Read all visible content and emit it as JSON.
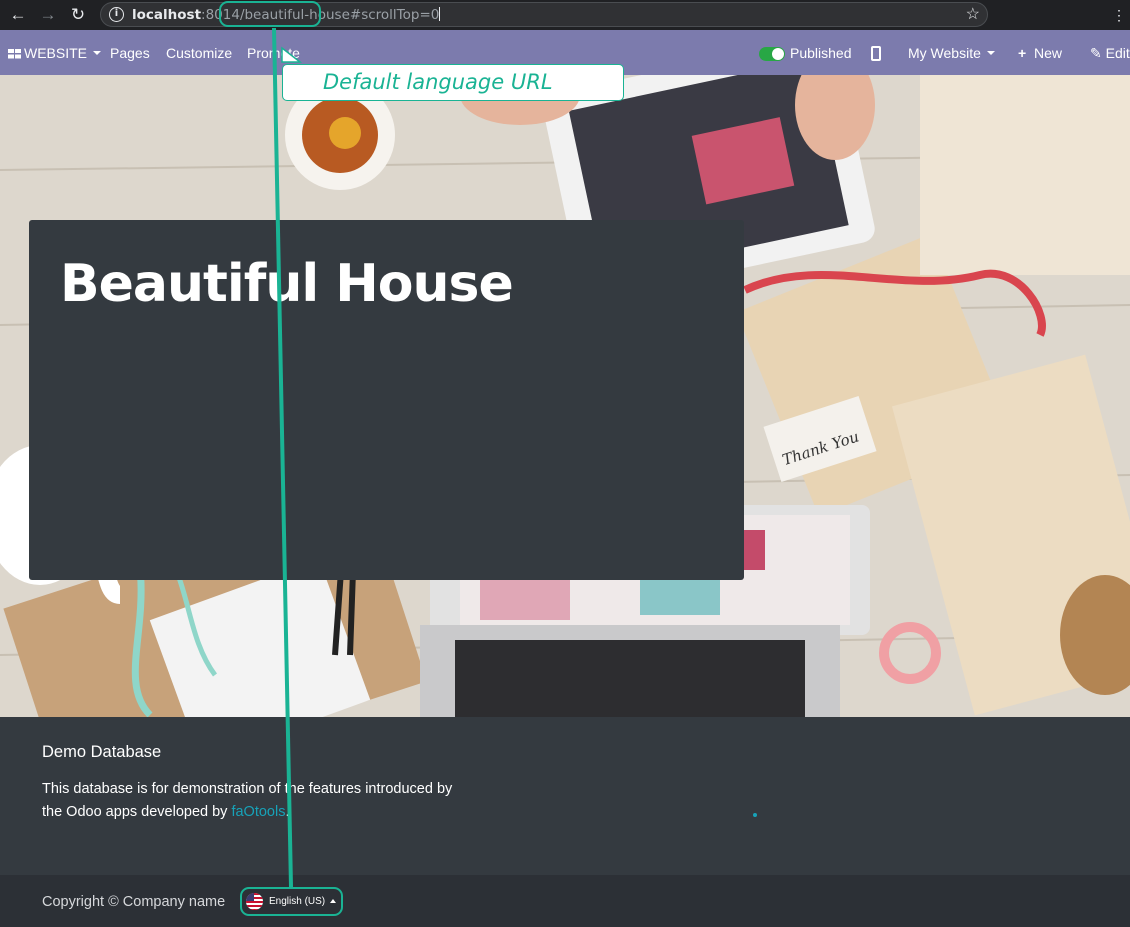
{
  "browser": {
    "url_host": "localhost",
    "url_port": ":8014",
    "url_path": "/beautiful-house",
    "url_fragment": "#scrollTop=0",
    "icons": [
      "back-arrow-icon",
      "forward-arrow-icon",
      "reload-icon",
      "info-icon",
      "star-icon"
    ]
  },
  "odoo_nav": {
    "website_menu": "WEBSITE",
    "pages": "Pages",
    "customize": "Customize",
    "promote": "Promote",
    "published": "Published",
    "my_website": "My Website",
    "new": "New",
    "edit": "Edit",
    "published_on": true
  },
  "hero": {
    "title": "Beautiful House"
  },
  "footer": {
    "title": "Demo Database",
    "text_before": "This database is for demonstration of the features introduced by the Odoo apps developed by ",
    "link": "faOtools",
    "text_after": "."
  },
  "copyright": {
    "text": "Copyright © Company name",
    "language": "English (US)"
  },
  "annotation": {
    "callout": "Default language URL",
    "color": "#1ab394"
  },
  "colors": {
    "odoo_nav": "#7c7bad",
    "dark_panel": "#343a40",
    "link": "#17a2b8",
    "toggle_on": "#28a745"
  }
}
